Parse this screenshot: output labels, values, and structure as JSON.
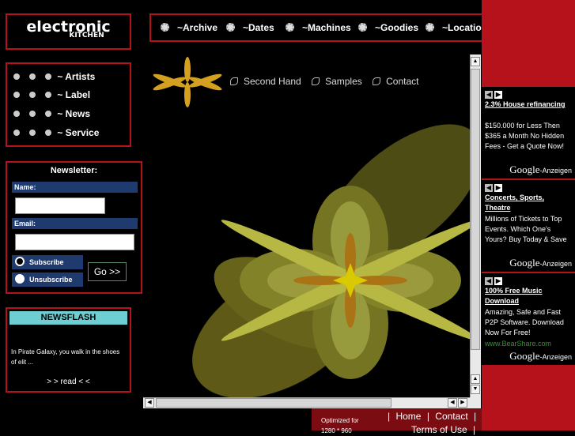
{
  "logo": {
    "line1": "electronic",
    "line2": "KITCHEN"
  },
  "topnav": [
    {
      "label": "~Archive"
    },
    {
      "label": "~Dates"
    },
    {
      "label": "~Machines"
    },
    {
      "label": "~Goodies"
    },
    {
      "label": "~Locatio"
    }
  ],
  "sidenav": [
    {
      "label": "~ Artists"
    },
    {
      "label": "~ Label"
    },
    {
      "label": "~ News"
    },
    {
      "label": "~ Service"
    }
  ],
  "newsletter": {
    "title": "Newsletter:",
    "name_label": "Name:",
    "email_label": "Email:",
    "subscribe": "Subscribe",
    "unsubscribe": "Unsubscribe",
    "go": "Go >>"
  },
  "newsflash": {
    "title": "NEWSFLASH",
    "text": "In Pirate Galaxy, you walk in the shoes of elit ...",
    "more": "> > read < <"
  },
  "subnav": [
    {
      "label": "Second Hand"
    },
    {
      "label": "Samples"
    },
    {
      "label": "Contact"
    }
  ],
  "ads": [
    {
      "title": "2.3% House refinancing",
      "body": "$150.000 for Less Then $365 a Month No Hidden Fees - Get a Quote Now!",
      "brand": "Google",
      "suffix": "-Anzeigen"
    },
    {
      "title": "Concerts, Sports, Theatre",
      "body": "Millions of Tickets to Top Events. Which One's Yours? Buy Today & Save",
      "brand": "Google",
      "suffix": "-Anzeigen"
    },
    {
      "title": "100% Free Music Download",
      "body": "Amazing, Safe and Fast P2P Software. Download Now For Free!",
      "url": "www.BearShare.com",
      "brand": "Google",
      "suffix": "-Anzeigen"
    }
  ],
  "footer": {
    "optimized": "Optimized for",
    "resolution": "1280 * 960",
    "home": "Home",
    "contact": "Contact",
    "terms": "Terms of Use",
    "sep": "|"
  },
  "colors": {
    "accent_red": "#b5121b",
    "panel_blue": "#1e3a6e",
    "newsflash_cyan": "#6ecfd3",
    "flower_yellow": "#e8e84a"
  },
  "icons": {
    "nav": "gear-icon",
    "sub": "swirl-icon"
  }
}
